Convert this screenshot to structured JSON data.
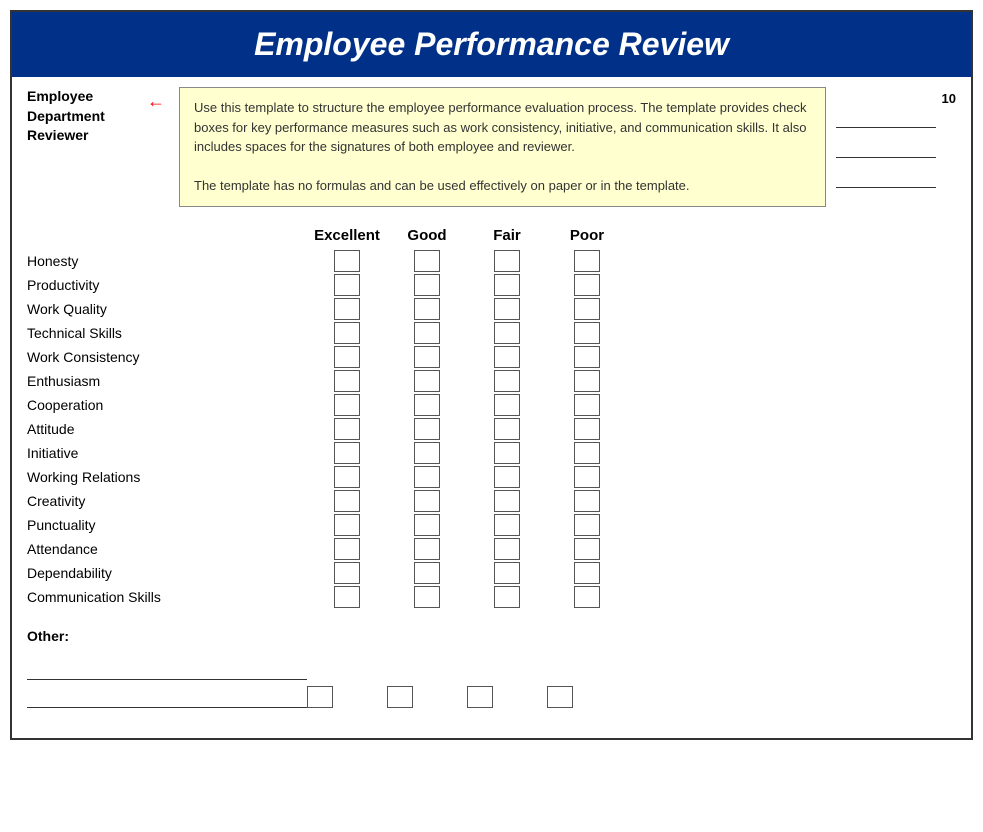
{
  "header": {
    "title": "Employee Performance Review"
  },
  "top_section": {
    "labels": [
      "Employee",
      "Department",
      "Reviewer"
    ],
    "date_label": "10",
    "tooltip": "Use this template to structure the employee performance evaluation process. The template provides check boxes for key performance measures such as work consistency, initiative, and communication skills. It also includes spaces for the signatures of both employee and reviewer.\n\nThe template has no formulas and can be used effectively on paper or in the template."
  },
  "ratings": {
    "columns": [
      "",
      "Excellent",
      "Good",
      "Fair",
      "Poor"
    ],
    "items": [
      "Honesty",
      "Productivity",
      "Work Quality",
      "Technical Skills",
      "Work Consistency",
      "Enthusiasm",
      "Cooperation",
      "Attitude",
      "Initiative",
      "Working Relations",
      "Creativity",
      "Punctuality",
      "Attendance",
      "Dependability",
      "Communication Skills"
    ]
  },
  "other": {
    "label": "Other:"
  }
}
